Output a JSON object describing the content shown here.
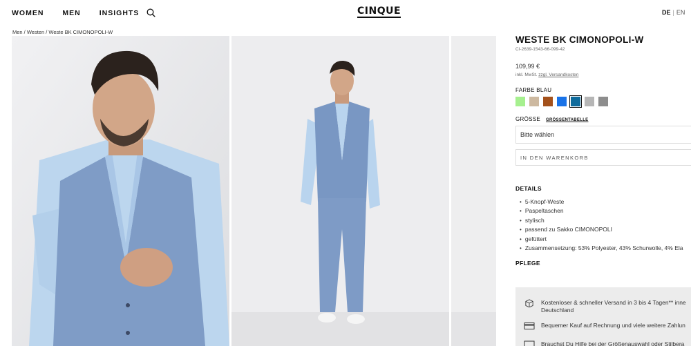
{
  "nav": {
    "items": [
      "WOMEN",
      "MEN",
      "INSIGHTS"
    ],
    "search_icon": "search-icon"
  },
  "brand": {
    "logo": "CINQUE"
  },
  "language": {
    "active": "DE",
    "separator": "|",
    "other": "EN"
  },
  "breadcrumb": "Men / Westen / Weste BK CIMONOPOLI-W",
  "product": {
    "title": "WESTE BK CIMONOPOLI-W",
    "sku": "CI-2639-1543-66-099-42",
    "price": "109,99 €",
    "tax_text": "inkl. MwSt. ",
    "tax_link": "zzgl. Versandkosten",
    "color_label": "FARBE BLAU",
    "swatches": [
      "#a6f08f",
      "#cdb9a0",
      "#a4511b",
      "#1a73e8",
      "#0f6b9c",
      "#b6b6b6",
      "#8d8d8d"
    ],
    "selected_swatch_index": 4,
    "size_label": "GRÖSSE",
    "size_table_link": "GRÖSSENTABELLE",
    "size_select": "Bitte wählen",
    "cart_button": "IN DEN WARENKORB",
    "details_heading": "DETAILS",
    "details": [
      "5-Knopf-Weste",
      "Paspeltaschen",
      "stylisch",
      "passend zu Sakko CIMONOPOLI",
      "gefüttert",
      "Zusammensetzung: 53% Polyester, 43% Schurwolle, 4% Ela"
    ],
    "care_heading": "PFLEGE"
  },
  "info": [
    {
      "icon": "box-icon",
      "line1": "Kostenloser & schneller Versand in 3 bis 4 Tagen** inne",
      "line2": "Deutschland"
    },
    {
      "icon": "card-icon",
      "line1": "Bequemer Kauf auf Rechnung und viele weitere Zahlun",
      "line2": ""
    },
    {
      "icon": "chat-icon",
      "line1": "Brauchst Du Hilfe bei der Größenauswahl oder Stilbera",
      "line2": ""
    }
  ]
}
